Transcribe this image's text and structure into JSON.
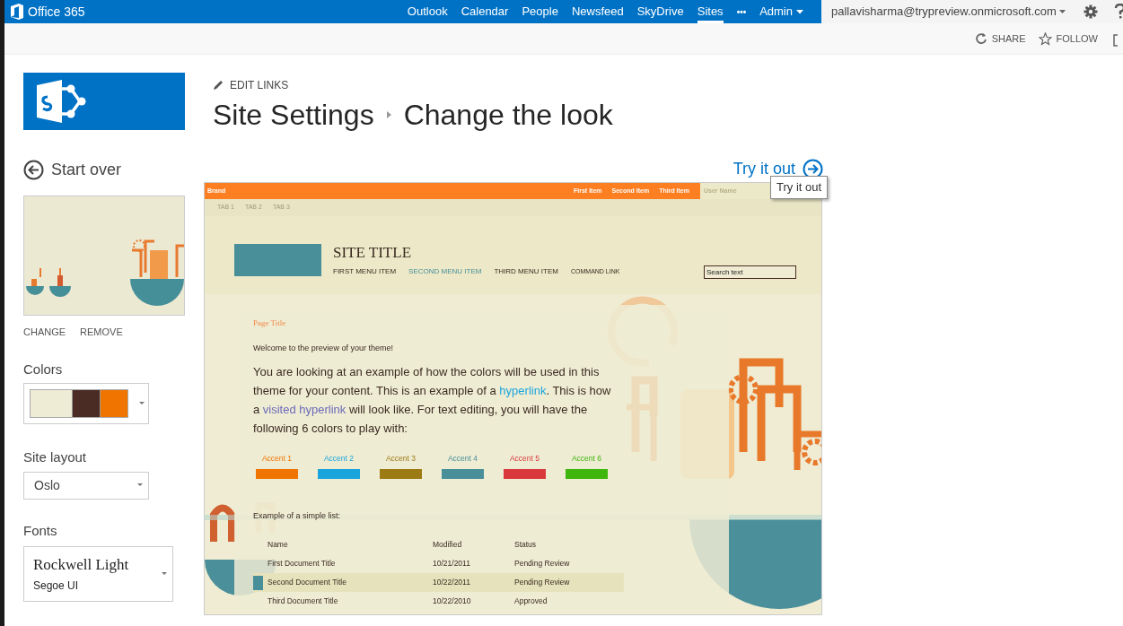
{
  "top_bar": {
    "brand": "Office 365",
    "links": [
      {
        "label": "Outlook",
        "selected": false
      },
      {
        "label": "Calendar",
        "selected": false
      },
      {
        "label": "People",
        "selected": false
      },
      {
        "label": "Newsfeed",
        "selected": false
      },
      {
        "label": "SkyDrive",
        "selected": false
      },
      {
        "label": "Sites",
        "selected": true
      }
    ],
    "more": "•••",
    "admin": "Admin",
    "user": "pallavisharma@trypreview.onmicrosoft.com"
  },
  "actions": [
    "SHARE",
    "FOLLOW"
  ],
  "edit_links": "EDIT LINKS",
  "breadcrumb": [
    "Site Settings",
    "Change the look"
  ],
  "start_over": "Start over",
  "try_it_out": "Try it out",
  "tooltip": "Try it out",
  "sidebar": {
    "thumbnail": {
      "kind": "picture"
    },
    "actions": [
      "CHANGE",
      "REMOVE"
    ],
    "colors_label": "Colors",
    "swatches": [
      {
        "color": "#efecd6"
      },
      {
        "color": "#4a2c24"
      },
      {
        "color": "#f07500"
      }
    ],
    "layout_label": "Site layout",
    "layout_value": "Oslo",
    "fonts_label": "Fonts",
    "heading_font": "Rockwell Light",
    "body_font": "Segoe UI"
  },
  "preview": {
    "brand": "Brand",
    "nav_items": [
      "First Item",
      "Second Item",
      "Third Item"
    ],
    "user_name": "User Name",
    "tabs": [
      "TAB 1",
      "TAB 2",
      "TAB 3"
    ],
    "site_title": "SITE TITLE",
    "menu": [
      {
        "label": "FIRST MENU ITEM",
        "kind": "item",
        "selected": false
      },
      {
        "label": "SECOND MENU ITEM",
        "kind": "item",
        "selected": true
      },
      {
        "label": "THIRD MENU ITEM",
        "kind": "item",
        "selected": false
      },
      {
        "label": "COMMAND LINK",
        "kind": "command",
        "selected": false
      }
    ],
    "search": {
      "placeholder": "Search text"
    },
    "page_title": "Page Title",
    "welcome": "Welcome to the preview of your theme!",
    "paragraph": [
      {
        "kind": "plain",
        "text": "You are looking at an example of how the colors will be used in this theme for your content. This is an example of a "
      },
      {
        "kind": "link",
        "text": "hyperlink"
      },
      {
        "kind": "plain",
        "text": ". This is how a "
      },
      {
        "kind": "visited",
        "text": "visited hyperlink"
      },
      {
        "kind": "plain",
        "text": " will look like. For text editing, you will have the following 6 colors to play with:"
      }
    ],
    "accents": [
      {
        "label": "Accent 1",
        "color": "#f07500"
      },
      {
        "label": "Accent 2",
        "color": "#19a5dc"
      },
      {
        "label": "Accent 3",
        "color": "#9c7a14"
      },
      {
        "label": "Accent 4",
        "color": "#488f99"
      },
      {
        "label": "Accent 5",
        "color": "#d9393c"
      },
      {
        "label": "Accent 6",
        "color": "#3eb60e"
      }
    ],
    "list_title": "Example of a simple list:",
    "columns": [
      "Name",
      "Modified",
      "Status"
    ],
    "rows": [
      {
        "cells": [
          "First Document Title",
          "10/21/2011",
          "Pending Review"
        ],
        "selected": false
      },
      {
        "cells": [
          "Second Document Title",
          "10/22/2011",
          "Pending Review"
        ],
        "selected": true
      },
      {
        "cells": [
          "Third Document Title",
          "10/22/2010",
          "Approved"
        ],
        "selected": false
      }
    ]
  }
}
